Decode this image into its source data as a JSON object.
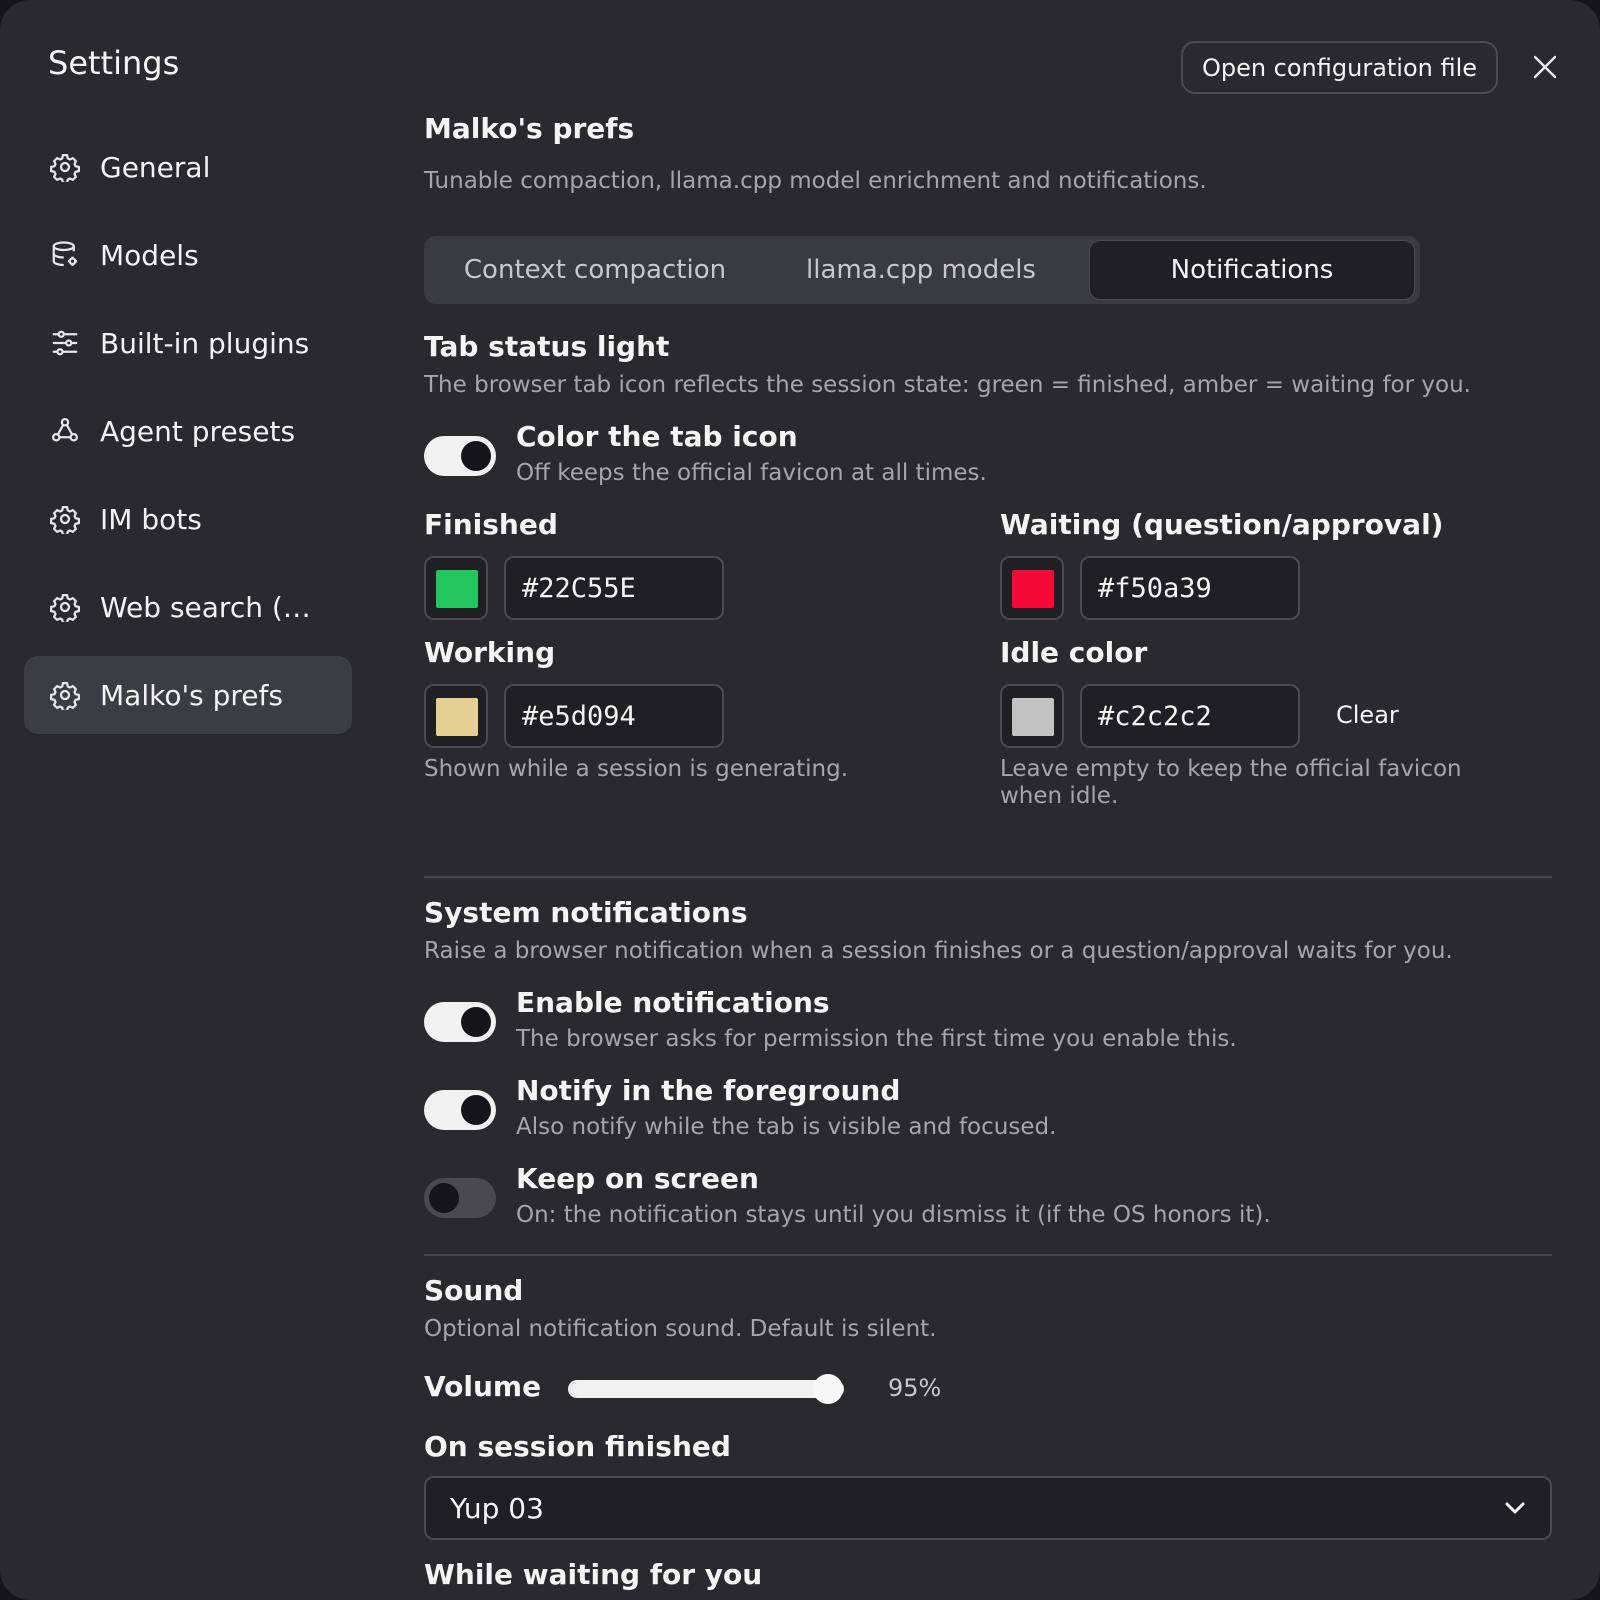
{
  "window": {
    "title": "Settings",
    "open_config_label": "Open configuration file"
  },
  "sidebar": {
    "items": [
      {
        "label": "General",
        "icon": "gear-icon"
      },
      {
        "label": "Models",
        "icon": "database-icon"
      },
      {
        "label": "Built-in plugins",
        "icon": "sliders-icon"
      },
      {
        "label": "Agent presets",
        "icon": "nodes-icon"
      },
      {
        "label": "IM bots",
        "icon": "gear-icon"
      },
      {
        "label": "Web search (…",
        "icon": "gear-icon"
      },
      {
        "label": "Malko's prefs",
        "icon": "gear-icon",
        "active": true
      }
    ]
  },
  "page": {
    "title": "Malko's prefs",
    "subtitle": "Tunable compaction, llama.cpp model enrichment and notifications.",
    "tabs": [
      {
        "label": "Context compaction"
      },
      {
        "label": "llama.cpp models"
      },
      {
        "label": "Notifications",
        "active": true
      }
    ]
  },
  "tab_status": {
    "heading": "Tab status light",
    "desc": "The browser tab icon reflects the session state: green = finished, amber = waiting for you.",
    "toggle": {
      "title": "Color the tab icon",
      "desc": "Off keeps the official favicon at all times.",
      "on": true
    },
    "finished": {
      "label": "Finished",
      "value": "#22C55E",
      "color": "#22c55e"
    },
    "waiting": {
      "label": "Waiting (question/approval)",
      "value": "#f50a39",
      "color": "#f50a39"
    },
    "working": {
      "label": "Working",
      "value": "#e5d094",
      "color": "#e5d094",
      "hint": "Shown while a session is generating."
    },
    "idle": {
      "label": "Idle color",
      "value": "#c2c2c2",
      "color": "#c2c2c2",
      "clear_label": "Clear",
      "hint_line1": "Leave empty to keep the official favicon",
      "hint_line2": "when idle."
    }
  },
  "system_notifications": {
    "heading": "System notifications",
    "desc": "Raise a browser notification when a session finishes or a question/approval waits for you.",
    "toggles": [
      {
        "title": "Enable notifications",
        "desc": "The browser asks for permission the first time you enable this.",
        "on": true
      },
      {
        "title": "Notify in the foreground",
        "desc": "Also notify while the tab is visible and focused.",
        "on": true
      },
      {
        "title": "Keep on screen",
        "desc": "On: the notification stays until you dismiss it (if the OS honors it).",
        "on": false
      }
    ]
  },
  "sound": {
    "heading": "Sound",
    "desc": "Optional notification sound. Default is silent.",
    "volume_label": "Volume",
    "volume_value": 0.95,
    "volume_text": "95%",
    "on_finished_label": "On session finished",
    "on_finished_value": "Yup 03",
    "while_waiting_label": "While waiting for you"
  }
}
